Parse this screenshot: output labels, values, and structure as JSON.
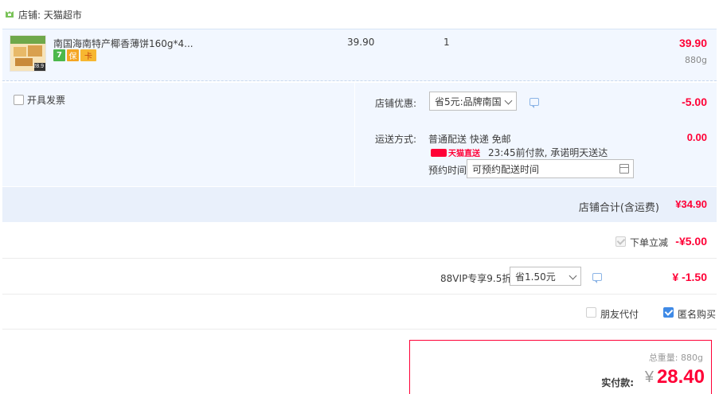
{
  "shop": {
    "name": "店铺: 天猫超市",
    "icon": "tmall-store-icon"
  },
  "item": {
    "title": "南国海南特产椰香薄饼160g*4...",
    "thumb_caption": "28.9",
    "unit_price": "39.90",
    "quantity": "1",
    "subtotal": "39.90",
    "weight": "880g",
    "badges": [
      "7",
      "保",
      "卡"
    ]
  },
  "invoice": {
    "label": "开具发票",
    "checked": false
  },
  "store_discount": {
    "label": "店铺优惠:",
    "option": "省5元:品牌南国",
    "amount": "-5.00"
  },
  "shipping": {
    "label": "运送方式:",
    "method": "普通配送 快递 免邮",
    "tmall_tag": "天猫直送",
    "promise": "23:45前付款, 承诺明天送达",
    "booking_label": "预约时间",
    "booking_value": "可预约配送时间",
    "fee": "0.00"
  },
  "store_total": {
    "label": "店铺合计(含运费)",
    "value": "¥34.90"
  },
  "instant_discount": {
    "label": "下单立减",
    "value": "-¥5.00"
  },
  "vip": {
    "label": "88VIP专享9.5折",
    "option": "省1.50元",
    "value": "¥ -1.50"
  },
  "options": {
    "friend_pay": "朋友代付",
    "anonymous": "匿名购买"
  },
  "summary": {
    "weight_label": "总重量: 880g",
    "pay_label": "实付款:",
    "currency": "¥",
    "pay_value": "28.40"
  },
  "colors": {
    "accent": "#ff0036",
    "panel_bg": "#f2f7ff",
    "checkbox_blue": "#3f8ae6"
  }
}
